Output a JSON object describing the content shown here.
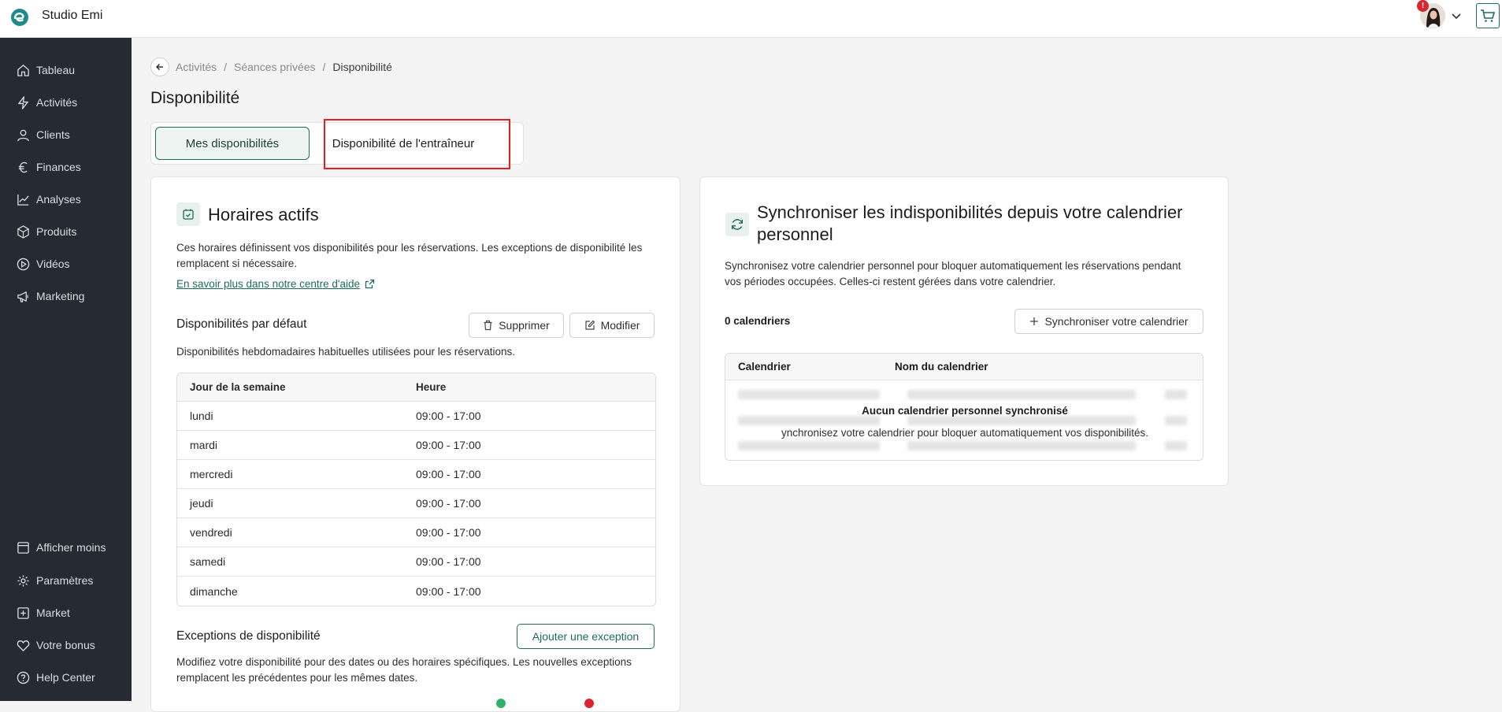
{
  "app": {
    "studio_name": "Studio Emi",
    "badge": "!"
  },
  "sidebar": {
    "items": [
      {
        "label": "Tableau",
        "icon": "home-icon"
      },
      {
        "label": "Activités",
        "icon": "bolt-icon"
      },
      {
        "label": "Clients",
        "icon": "user-icon"
      },
      {
        "label": "Finances",
        "icon": "euro-icon"
      },
      {
        "label": "Analyses",
        "icon": "chart-line-icon"
      },
      {
        "label": "Produits",
        "icon": "box-icon"
      },
      {
        "label": "Vidéos",
        "icon": "play-icon"
      },
      {
        "label": "Marketing",
        "icon": "megaphone-icon"
      }
    ],
    "bottom_items": [
      {
        "label": "Afficher moins",
        "icon": "panel-icon"
      },
      {
        "label": "Paramètres",
        "icon": "gear-icon"
      },
      {
        "label": "Market",
        "icon": "plus-square-icon"
      },
      {
        "label": "Votre bonus",
        "icon": "heart-icon"
      },
      {
        "label": "Help Center",
        "icon": "help-icon"
      }
    ]
  },
  "breadcrumb": {
    "items": [
      "Activités",
      "Séances privées",
      "Disponibilité"
    ],
    "separator": "/"
  },
  "page": {
    "title": "Disponibilité"
  },
  "tabs": {
    "tab1": "Mes disponibilités",
    "tab2": "Disponibilité de l'entraîneur"
  },
  "left_card": {
    "title": "Horaires actifs",
    "description": "Ces horaires définissent vos disponibilités pour les réservations. Les exceptions de disponibilité les remplacent si nécessaire.",
    "help_link": "En savoir plus dans notre centre d'aide",
    "default_section": {
      "title": "Disponibilités par défaut",
      "delete_label": "Supprimer",
      "edit_label": "Modifier",
      "description": "Disponibilités hebdomadaires habituelles utilisées pour les réservations."
    },
    "table": {
      "headers": [
        "Jour de la semaine",
        "Heure"
      ],
      "rows": [
        [
          "lundi",
          "09:00 - 17:00"
        ],
        [
          "mardi",
          "09:00 - 17:00"
        ],
        [
          "mercredi",
          "09:00 - 17:00"
        ],
        [
          "jeudi",
          "09:00 - 17:00"
        ],
        [
          "vendredi",
          "09:00 - 17:00"
        ],
        [
          "samedi",
          "09:00 - 17:00"
        ],
        [
          "dimanche",
          "09:00 - 17:00"
        ]
      ]
    },
    "exceptions": {
      "title": "Exceptions de disponibilité",
      "add_label": "Ajouter une exception",
      "description": "Modifiez votre disponibilité pour des dates ou des horaires spécifiques. Les nouvelles exceptions remplacent les précédentes pour les mêmes dates."
    }
  },
  "right_card": {
    "title": "Synchroniser les indisponibilités depuis votre calendrier personnel",
    "description": "Synchronisez votre calendrier personnel pour bloquer automatiquement les réservations pendant vos périodes occupées. Celles-ci restent gérées dans votre calendrier.",
    "count": "0 calendriers",
    "sync_label": "Synchroniser votre calendrier",
    "table_headers": [
      "Calendrier",
      "Nom du calendrier"
    ],
    "empty_title": "Aucun calendrier personnel synchronisé",
    "empty_sub": "ynchronisez votre calendrier pour bloquer automatiquement vos disponibilités."
  },
  "colors": {
    "accent": "#1e6b5a",
    "sidebar_bg": "#262b33",
    "highlight": "#e02020",
    "badge": "#d7262e"
  }
}
